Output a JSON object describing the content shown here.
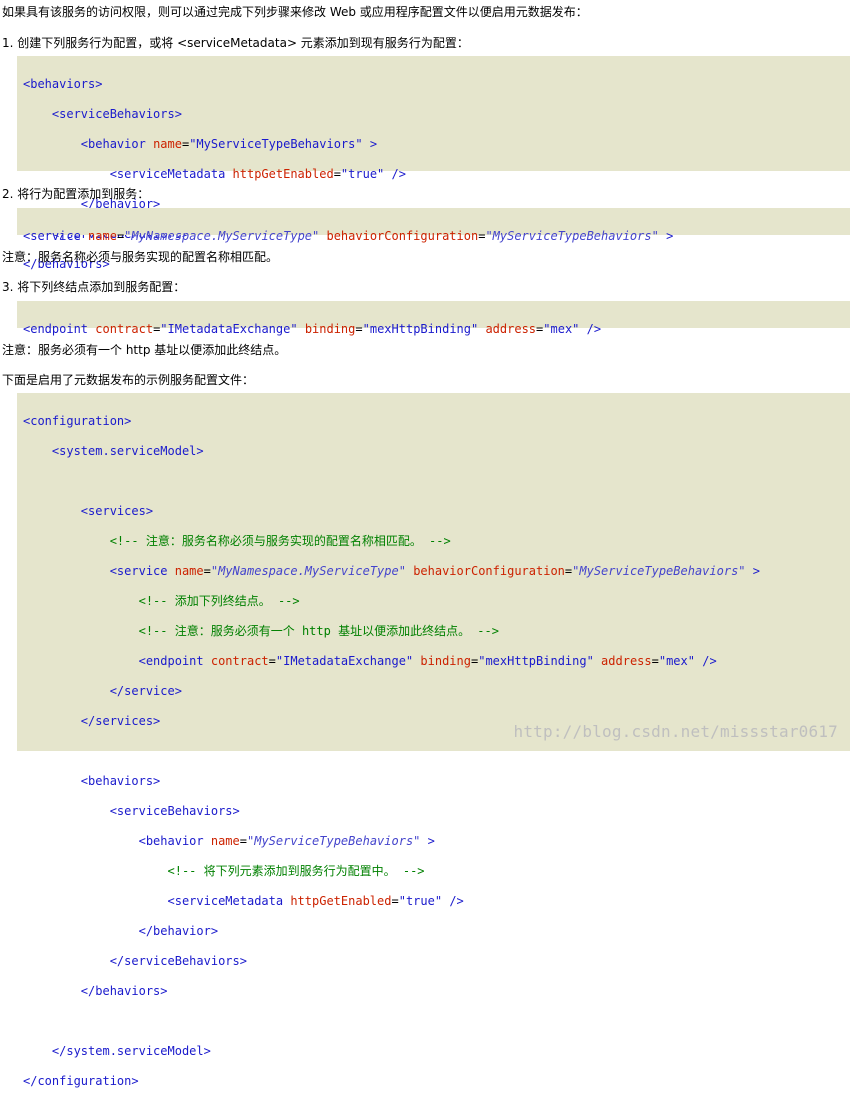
{
  "intro": "如果具有该服务的访问权限，则可以通过完成下列步骤来修改 Web 或应用程序配置文件以便启用元数据发布：",
  "step1": "1. 创建下列服务行为配置，或将 <serviceMetadata> 元素添加到现有服务行为配置：",
  "code1": {
    "l1": "<behaviors>",
    "l2": "<serviceBehaviors>",
    "l3_tag": "<behavior",
    "l3_attr": "name",
    "l3_val": "\"MyServiceTypeBehaviors\"",
    "l3_end": ">",
    "l4_tag": "<serviceMetadata",
    "l4_attr": "httpGetEnabled",
    "l4_val": "\"true\"",
    "l4_end": "/>",
    "l5": "</behavior>",
    "l6": "</serviceBehaviors>",
    "l7": "</behaviors>"
  },
  "step2": "2. 将行为配置添加到服务：",
  "code2": {
    "tag": "<service",
    "attr1": "name",
    "val1": "\"MyNamespace.MyServiceType\"",
    "attr2": "behaviorConfiguration",
    "val2": "\"MyServiceTypeBehaviors\"",
    "end": ">"
  },
  "note1": "注意：服务名称必须与服务实现的配置名称相匹配。",
  "step3": "3. 将下列终结点添加到服务配置：",
  "code3": {
    "tag": "<endpoint",
    "attr1": "contract",
    "val1": "\"IMetadataExchange\"",
    "attr2": "binding",
    "val2": "\"mexHttpBinding\"",
    "attr3": "address",
    "val3": "\"mex\"",
    "end": "/>"
  },
  "note2": "注意：服务必须有一个 http 基址以便添加此终结点。",
  "sample_intro": "下面是启用了元数据发布的示例服务配置文件：",
  "code4": {
    "l1": "<configuration>",
    "l2": "<system.serviceModel>",
    "l4": "<services>",
    "l5": "<!-- 注意：服务名称必须与服务实现的配置名称相匹配。 -->",
    "l6_tag": "<service",
    "l6_a1": "name",
    "l6_v1": "\"MyNamespace.MyServiceType\"",
    "l6_a2": "behaviorConfiguration",
    "l6_v2": "\"MyServiceTypeBehaviors\"",
    "l6_end": ">",
    "l7": "<!-- 添加下列终结点。 -->",
    "l8": "<!-- 注意：服务必须有一个 http 基址以便添加此终结点。 -->",
    "l9_tag": "<endpoint",
    "l9_a1": "contract",
    "l9_v1": "\"IMetadataExchange\"",
    "l9_a2": "binding",
    "l9_v2": "\"mexHttpBinding\"",
    "l9_a3": "address",
    "l9_v3": "\"mex\"",
    "l9_end": "/>",
    "l10": "</service>",
    "l11": "</services>",
    "l13": "<behaviors>",
    "l14": "<serviceBehaviors>",
    "l15_tag": "<behavior",
    "l15_a": "name",
    "l15_v": "\"MyServiceTypeBehaviors\"",
    "l15_end": ">",
    "l16": "<!-- 将下列元素添加到服务行为配置中。 -->",
    "l17_tag": "<serviceMetadata",
    "l17_a": "httpGetEnabled",
    "l17_v": "\"true\"",
    "l17_end": "/>",
    "l18": "</behavior>",
    "l19": "</serviceBehaviors>",
    "l20": "</behaviors>",
    "l22": "</system.serviceModel>",
    "l23": "</configuration>"
  },
  "watermark": "http://blog.csdn.net/missstar0617"
}
